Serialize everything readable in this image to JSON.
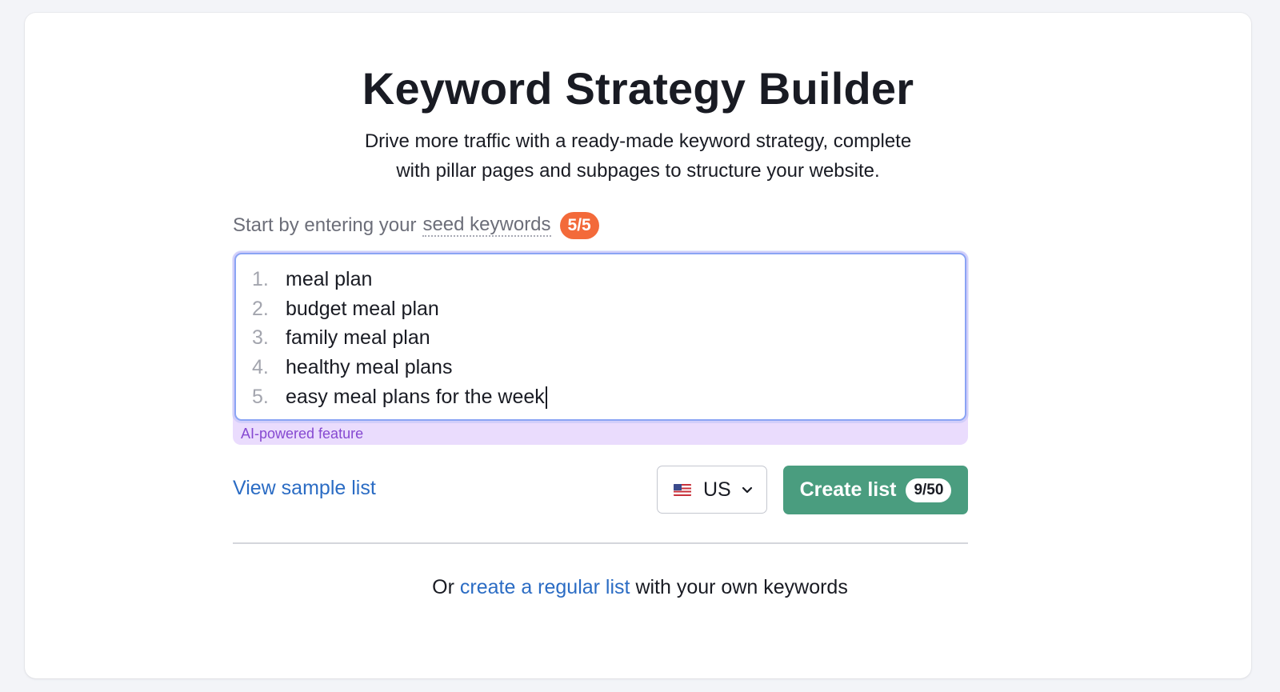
{
  "header": {
    "title": "Keyword Strategy Builder",
    "subtitle_line1": "Drive more traffic with a ready-made keyword strategy, complete",
    "subtitle_line2": "with pillar pages and subpages to structure your website."
  },
  "seed": {
    "prompt": "Start by entering your",
    "hint_term": "seed keywords",
    "counter": "5/5",
    "keywords": [
      {
        "num": "1.",
        "text": "meal plan"
      },
      {
        "num": "2.",
        "text": "budget meal plan"
      },
      {
        "num": "3.",
        "text": "family meal plan"
      },
      {
        "num": "4.",
        "text": "healthy meal plans"
      },
      {
        "num": "5.",
        "text": "easy meal plans for the week"
      }
    ],
    "ai_label": "AI-powered feature"
  },
  "actions": {
    "sample_link": "View sample list",
    "country": {
      "code": "US",
      "flag_icon": "us-flag-icon"
    },
    "create_button": "Create list",
    "credits": "9/50"
  },
  "footer": {
    "prefix": "Or",
    "link": "create a regular list",
    "suffix": "with your own keywords"
  },
  "colors": {
    "accent_green": "#4a9d7f",
    "badge_orange": "#f36a3a",
    "link_blue": "#2b6cc4",
    "ai_purple_bg": "#eadcfd",
    "ai_purple_text": "#8649d1"
  }
}
